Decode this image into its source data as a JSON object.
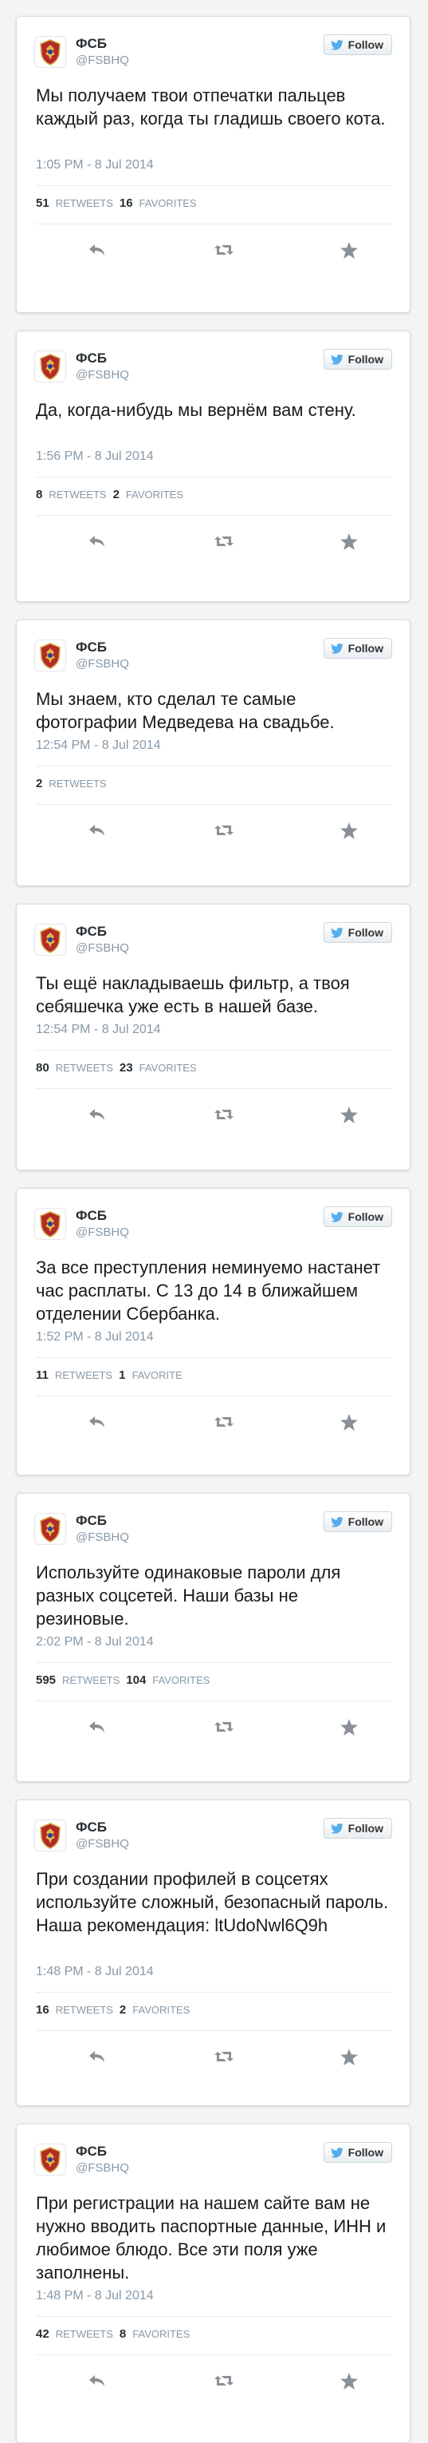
{
  "follow_label": "Follow",
  "retweets_label": "RETWEETS",
  "favorites_label": "FAVORITES",
  "favorite_label": "FAVORITE",
  "colors": {
    "accent": "#55acee",
    "muted": "#8899a6",
    "card": "#ffffff",
    "background": "#f4f4f4"
  },
  "tweets": [
    {
      "name": "ФСБ",
      "handle": "@FSBHQ",
      "text": "Мы получаем твои отпечатки пальцев каждый раз, когда ты гладишь своего кота.",
      "time": "1:05 PM - 8 Jul 2014",
      "retweets": "51",
      "favorites": "16"
    },
    {
      "name": "ФСБ",
      "handle": "@FSBHQ",
      "text": "Да, когда-нибудь мы вернём вам стену.",
      "time": "1:56 PM - 8 Jul 2014",
      "retweets": "8",
      "favorites": "2"
    },
    {
      "name": "ФСБ",
      "handle": "@FSBHQ",
      "text": "Мы знаем, кто сделал те самые фотографии Медведева на свадьбе.",
      "time": "12:54 PM - 8 Jul 2014",
      "retweets": "2"
    },
    {
      "name": "ФСБ",
      "handle": "@FSBHQ",
      "text": "Ты ещё накладываешь фильтр, а твоя себяшечка уже есть в нашей базе.",
      "time": "12:54 PM - 8 Jul 2014",
      "retweets": "80",
      "favorites": "23"
    },
    {
      "name": "ФСБ",
      "handle": "@FSBHQ",
      "text": "За все преступления неминуемо настанет час расплаты. С 13 до 14 в ближайшем отделении Сбербанка.",
      "time": "1:52 PM - 8 Jul 2014",
      "retweets": "11",
      "favorites": "1"
    },
    {
      "name": "ФСБ",
      "handle": "@FSBHQ",
      "text": "Используйте одинаковые пароли для разных соцсетей. Наши базы не резиновые.",
      "time": "2:02 PM - 8 Jul 2014",
      "retweets": "595",
      "favorites": "104"
    },
    {
      "name": "ФСБ",
      "handle": "@FSBHQ",
      "text": "При создании профилей в соцсетях используйте сложный, безопасный пароль. Наша рекомендация: ltUdoNwl6Q9h",
      "time": "1:48 PM - 8 Jul 2014",
      "retweets": "16",
      "favorites": "2"
    },
    {
      "name": "ФСБ",
      "handle": "@FSBHQ",
      "text": "При регистрации на нашем сайте вам не нужно вводить паспортные данные, ИНН и любимое блюдо. Все эти поля уже заполнены.",
      "time": "1:48 PM - 8 Jul 2014",
      "retweets": "42",
      "favorites": "8"
    }
  ]
}
